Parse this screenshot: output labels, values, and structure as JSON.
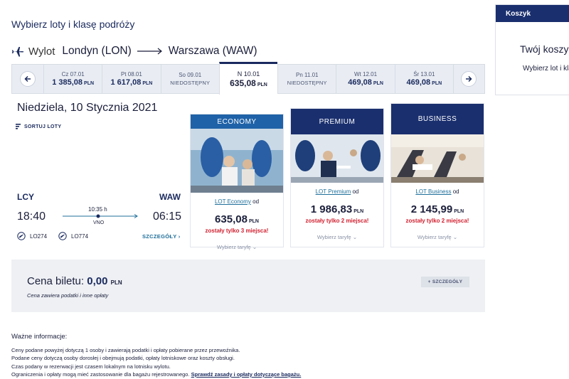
{
  "page_title": "Wybierz loty i klasę podróży",
  "route": {
    "label": "Wylot",
    "origin": "Londyn (LON)",
    "destination": "Warszawa (WAW)"
  },
  "date_bar": {
    "days": [
      {
        "name": "Cz 07.01",
        "price": "1 385,08",
        "currency": "PLN",
        "available": true
      },
      {
        "name": "Pt 08.01",
        "price": "1 617,08",
        "currency": "PLN",
        "available": true
      },
      {
        "name": "So 09.01",
        "status": "NIEDOSTĘPNY",
        "available": false
      },
      {
        "name": "N 10.01",
        "price": "635,08",
        "currency": "PLN",
        "available": true,
        "selected": true
      },
      {
        "name": "Pn 11.01",
        "status": "NIEDOSTĘPNY",
        "available": false
      },
      {
        "name": "Wt 12.01",
        "price": "469,08",
        "currency": "PLN",
        "available": true
      },
      {
        "name": "Śr 13.01",
        "price": "469,08",
        "currency": "PLN",
        "available": true
      }
    ]
  },
  "date_heading": "Niedziela, 10 Stycznia 2021",
  "sort_label": "SORTUJ LOTY",
  "flight": {
    "from_code": "LCY",
    "to_code": "WAW",
    "departure": "18:40",
    "arrival": "06:15",
    "duration": "10:35 h",
    "stop": "VNO",
    "flight_numbers": [
      "LO274",
      "LO774"
    ],
    "details_label": "SZCZEGÓŁY"
  },
  "fares": [
    {
      "class": "ECONOMY",
      "fare_name": "LOT Economy",
      "fare_suffix": "od",
      "price": "635,08",
      "currency": "PLN",
      "seats": "zostały tylko 3 miejsca!",
      "choose": "Wybierz taryfę"
    },
    {
      "class": "PREMIUM",
      "fare_name": "LOT Premium",
      "fare_suffix": "od",
      "price": "1 986,83",
      "currency": "PLN",
      "seats": "zostały tylko 2 miejsca!",
      "choose": "Wybierz taryfę"
    },
    {
      "class": "BUSINESS",
      "fare_name": "LOT Business",
      "fare_suffix": "od",
      "price": "2 145,99",
      "currency": "PLN",
      "seats": "zostały tylko 2 miejsca!",
      "choose": "Wybierz taryfę"
    }
  ],
  "summary": {
    "label": "Cena biletu:",
    "price": "0,00",
    "currency": "PLN",
    "note": "Cena zawiera podatki i inne opłaty",
    "details_button": "+ SZCZEGÓŁY"
  },
  "info": {
    "title": "Ważne informacje:",
    "lines": [
      "Ceny podane powyżej dotyczą 1 osoby i zawierają podatki i opłaty pobierane przez przewoźnika.",
      "Podane ceny dotyczą osoby dorosłej i obejmują podatki, opłaty lotniskowe oraz koszty obsługi.",
      "Czas podany w rezerwacji jest czasem lokalnym na lotnisku wylotu.",
      "Ograniczenia i opłaty mogą mieć zastosowanie dla bagażu rejestrowanego."
    ],
    "link": "Sprawdź zasady i opłaty dotyczące bagażu."
  },
  "cart": {
    "header": "Koszyk",
    "title": "Twój koszyk",
    "subtitle": "Wybierz lot i klasę"
  },
  "colors": {
    "navy": "#1a2f6e",
    "economy_blue": "#1f62a8",
    "link_blue": "#1f6f9a",
    "alert_red": "#d1202f"
  }
}
